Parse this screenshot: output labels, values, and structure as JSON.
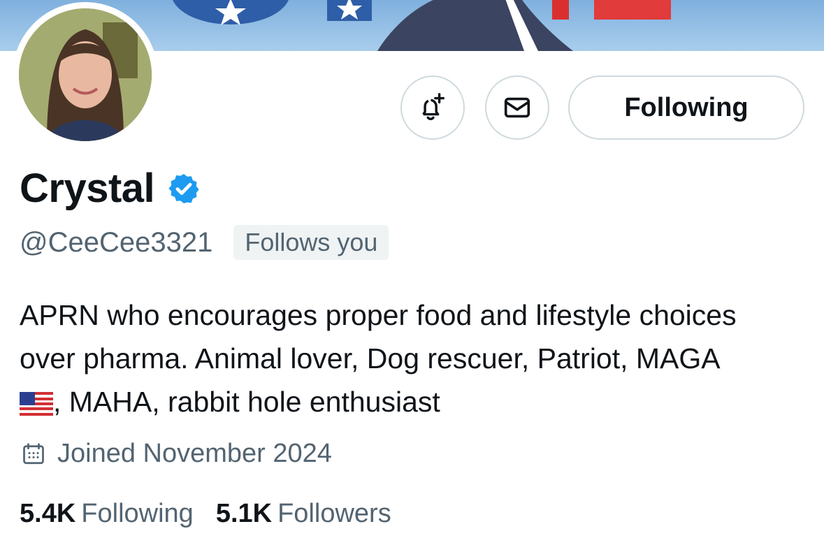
{
  "profile": {
    "name": "Crystal",
    "handle": "@CeeCee3321",
    "follows_you": "Follows you",
    "bio_line1": "APRN who encourages proper food and lifestyle choices",
    "bio_line2": "over pharma. Animal lover, Dog rescuer, Patriot, MAGA",
    "bio_line3": ", MAHA, rabbit hole enthusiast",
    "joined": "Joined November 2024",
    "following_count": "5.4K",
    "following_label": "Following",
    "followers_count": "5.1K",
    "followers_label": "Followers"
  },
  "actions": {
    "follow_button_label": "Following"
  },
  "icons": {
    "notify": "bell-plus-icon",
    "message": "envelope-icon",
    "verified": "verified-badge-icon",
    "calendar": "calendar-icon",
    "flag": "us-flag-emoji"
  },
  "colors": {
    "verified_blue": "#1d9bf0",
    "muted_text": "#536471",
    "border": "#cfd9de"
  }
}
